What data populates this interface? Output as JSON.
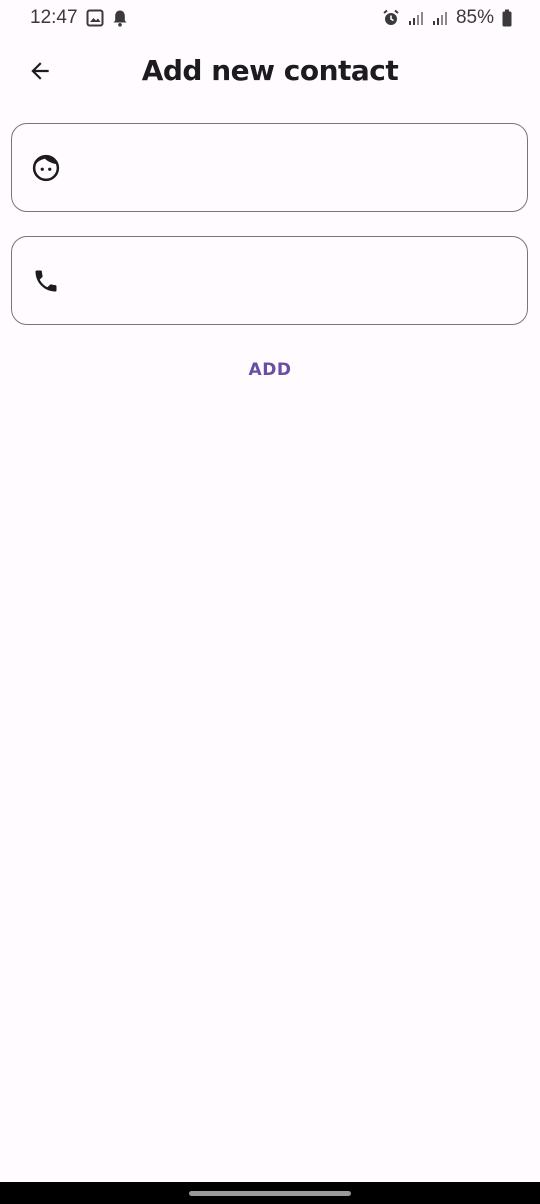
{
  "status_bar": {
    "time": "12:47",
    "battery": "85%",
    "left_icons": [
      "gallery-icon",
      "notification-bell-icon"
    ],
    "right_icons": [
      "alarm-icon",
      "signal-icon",
      "signal-icon",
      "battery-icon"
    ]
  },
  "app_bar": {
    "title": "Add new contact",
    "back_icon": "arrow-back-icon"
  },
  "form": {
    "name_field": {
      "icon": "face-icon",
      "value": "",
      "placeholder": ""
    },
    "phone_field": {
      "icon": "phone-icon",
      "value": "",
      "placeholder": ""
    },
    "add_label": "ADD"
  },
  "colors": {
    "background": "#fffbfe",
    "accent": "#6750a4",
    "outline": "#79747e",
    "text": "#1c1b1f"
  }
}
